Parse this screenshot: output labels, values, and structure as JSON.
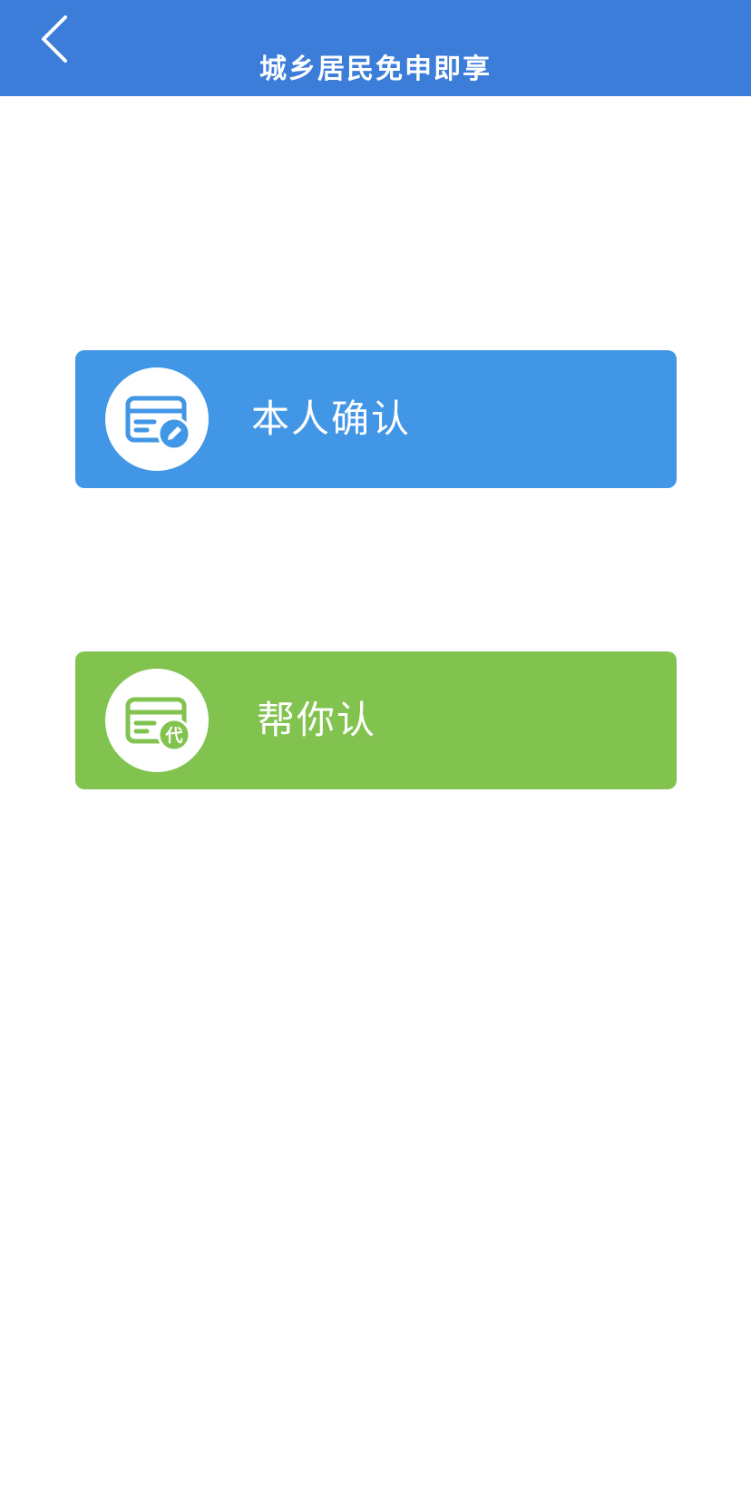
{
  "header": {
    "title": "城乡居民免申即享",
    "back_icon": "chevron-left-icon"
  },
  "options": [
    {
      "label": "本人确认",
      "icon": "card-edit-icon",
      "color": "#4296e6"
    },
    {
      "label": "帮你认",
      "icon": "card-proxy-icon",
      "badge": "代",
      "color": "#82c350"
    }
  ],
  "colors": {
    "header_bg": "#3b7dd8",
    "page_bg": "#ffffff"
  }
}
